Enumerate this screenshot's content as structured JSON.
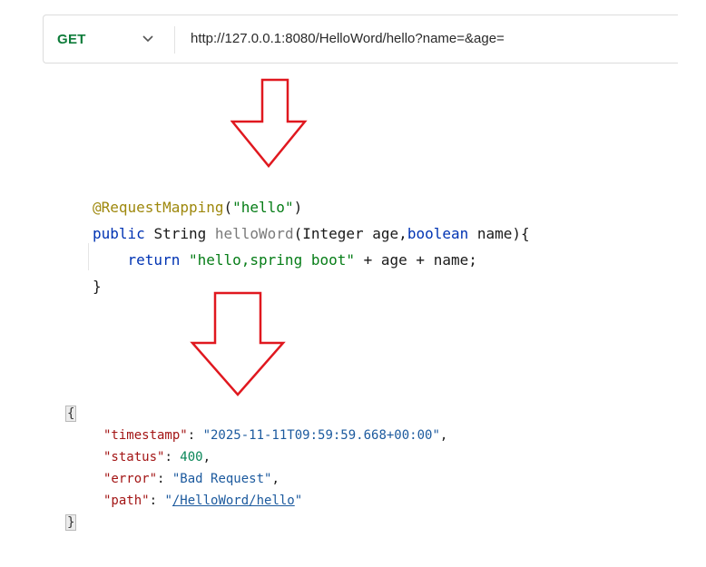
{
  "request": {
    "method": "GET",
    "url": "http://127.0.0.1:8080/HelloWord/hello?name=&age="
  },
  "code": {
    "annotation": "@RequestMapping",
    "annotation_open": "(",
    "annotation_value": "\"hello\"",
    "annotation_close": ")",
    "kw_public": "public",
    "type_string": "String",
    "method_name": "helloWord",
    "params_open": "(Integer age,",
    "kw_boolean": "boolean",
    "params_close": " name){",
    "kw_return": "return",
    "return_string": "\"hello,spring boot\"",
    "return_rest": " + age + name;",
    "closing_brace": "}"
  },
  "response": {
    "open_brace": "{",
    "close_brace": "}",
    "timestamp_key": "\"timestamp\"",
    "timestamp_value": "\"2025-11-11T09:59:59.668+00:00\"",
    "status_key": "\"status\"",
    "status_value": "400",
    "error_key": "\"error\"",
    "error_value": "\"Bad Request\"",
    "path_key": "\"path\"",
    "path_quote_open": "\"",
    "path_value": "/HelloWord/hello",
    "path_quote_close": "\""
  },
  "colors": {
    "method_green": "#0e7c3a",
    "arrow_red": "#e0181f"
  },
  "icons": {
    "method_dropdown": "chevron-down-icon",
    "flow_arrow": "down-arrow-icon"
  }
}
